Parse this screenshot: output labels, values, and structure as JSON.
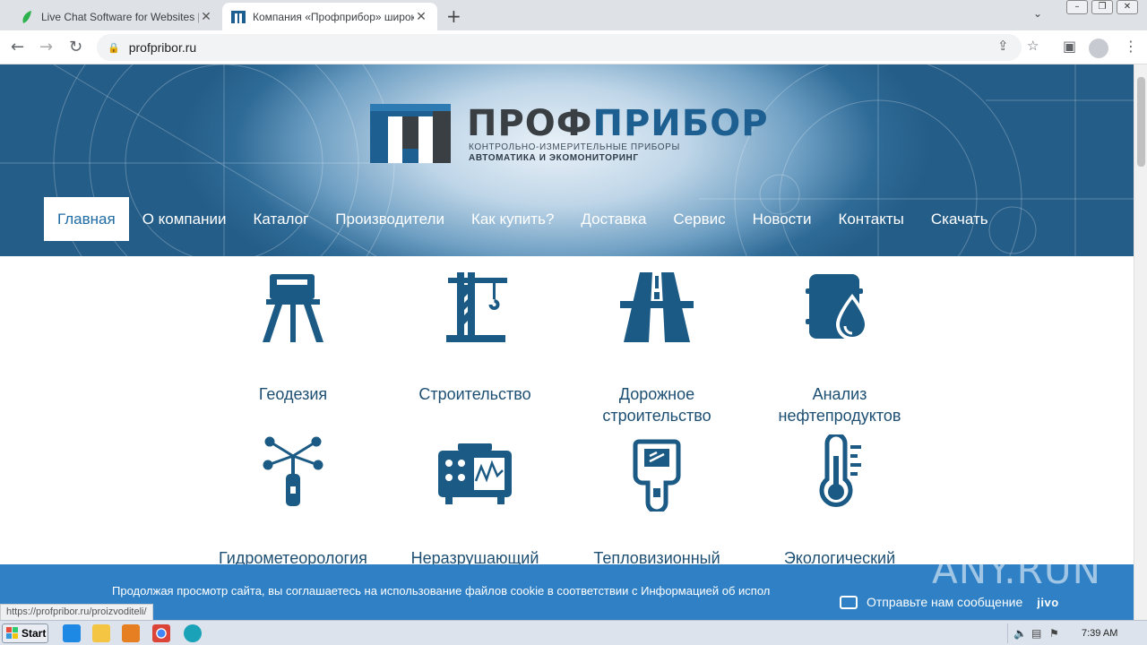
{
  "browser": {
    "tabs": [
      {
        "title": "Live Chat Software for Websites | Ji",
        "active": false,
        "favicon": "leaf-icon"
      },
      {
        "title": "Компания «Профприбор» широкий",
        "active": true,
        "favicon": "profpribor-icon"
      }
    ],
    "url": "profpribor.ru",
    "status_url": "https://profpribor.ru/proizvoditeli/"
  },
  "site": {
    "logo": {
      "brand_dark": "ПРОФ",
      "brand_blue": "ПРИБОР",
      "tagline1": "КОНТРОЛЬНО-ИЗМЕРИТЕЛЬНЫЕ ПРИБОРЫ",
      "tagline2": "АВТОМАТИКА И ЭКОМОНИТОРИНГ"
    },
    "nav": [
      "Главная",
      "О компании",
      "Каталог",
      "Производители",
      "Как купить?",
      "Доставка",
      "Сервис",
      "Новости",
      "Контакты",
      "Скачать"
    ],
    "nav_active": "Главная",
    "categories_row1": [
      {
        "label": "Геодезия",
        "icon": "tripod-level-icon"
      },
      {
        "label": "Строительство",
        "icon": "crane-icon"
      },
      {
        "label": "Дорожное строительство",
        "icon": "road-icon"
      },
      {
        "label": "Анализ нефтепродуктов",
        "icon": "oil-barrel-drop-icon"
      }
    ],
    "categories_row2": [
      {
        "label": "Гидрометеорология",
        "icon": "anemometer-icon"
      },
      {
        "label": "Неразрушающий",
        "icon": "flaw-detector-icon"
      },
      {
        "label": "Тепловизионный",
        "icon": "thermal-imager-icon"
      },
      {
        "label": "Экологический",
        "icon": "thermometer-icon"
      }
    ],
    "cookie_text": "Продолжая просмотр сайта, вы соглашаетесь на использование файлов cookie в соответствии с Информацией об испол",
    "chat": {
      "label": "Отправьте нам сообщение",
      "brand": "jivo"
    },
    "watermark": "ANY.RUN"
  },
  "taskbar": {
    "start_label": "Start",
    "clock": "7:39 AM"
  },
  "colors": {
    "accent": "#1f6ba3",
    "icon": "#1b5a84",
    "cookie_bg": "#2f80c5"
  }
}
